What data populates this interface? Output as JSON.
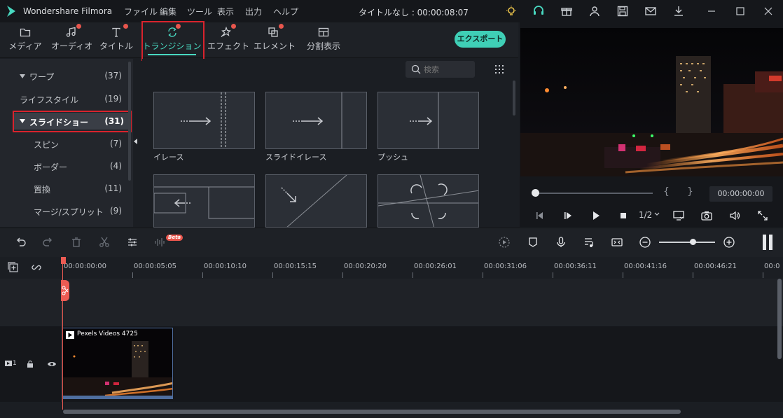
{
  "app": {
    "name": "Wondershare Filmora",
    "doc_title": "タイトルなし : 00:00:08:07"
  },
  "menu": [
    "ファイル",
    "編集",
    "ツール",
    "表示",
    "出力",
    "ヘルプ"
  ],
  "toolbar": {
    "tabs": [
      {
        "label": "メディア",
        "icon": "folder-icon",
        "dot": false
      },
      {
        "label": "オーディオ",
        "icon": "music-note-icon",
        "dot": true
      },
      {
        "label": "タイトル",
        "icon": "text-icon",
        "dot": true
      },
      {
        "label": "トランジション",
        "icon": "transition-icon",
        "dot": true,
        "active": true
      },
      {
        "label": "エフェクト",
        "icon": "effect-icon",
        "dot": true
      },
      {
        "label": "エレメント",
        "icon": "element-icon",
        "dot": true
      },
      {
        "label": "分割表示",
        "icon": "split-screen-icon",
        "dot": false
      }
    ],
    "export_label": "エクスポート"
  },
  "categories": [
    {
      "name": "ワープ",
      "count": "(37)",
      "expandable": true
    },
    {
      "name": "ライフスタイル",
      "count": "(19)"
    },
    {
      "name": "スライドショー",
      "count": "(31)",
      "expandable": true,
      "selected": true
    },
    {
      "name": "スピン",
      "count": "(7)"
    },
    {
      "name": "ボーダー",
      "count": "(4)"
    },
    {
      "name": "置換",
      "count": "(11)"
    },
    {
      "name": "マージ/スプリット",
      "count": "(9)"
    }
  ],
  "search": {
    "placeholder": "検索"
  },
  "transitions": [
    {
      "label": "イレース"
    },
    {
      "label": "スライドイレース"
    },
    {
      "label": "プッシュ"
    },
    {
      "label": ""
    },
    {
      "label": ""
    },
    {
      "label": ""
    }
  ],
  "preview": {
    "timecode": "00:00:00:00",
    "ratio": "1/2",
    "brace_open": "{",
    "brace_close": "}",
    "progress": 0
  },
  "timeline": {
    "ruler": [
      "00:00:00:00",
      "00:00:05:05",
      "00:00:10:10",
      "00:00:15:15",
      "00:00:20:20",
      "00:00:26:01",
      "00:00:31:06",
      "00:00:36:11",
      "00:00:41:16",
      "00:00:46:21",
      "00:0"
    ],
    "track_number": "1",
    "clip_name": "Pexels Videos 4725",
    "beta_badge": "Beta",
    "zoom": 0.55
  },
  "colors": {
    "accent": "#48d8c0",
    "export": "#3fcfb6",
    "playhead": "#ec5b53",
    "notification_dot": "#e8564d",
    "highlight_box": "#d9232d"
  }
}
